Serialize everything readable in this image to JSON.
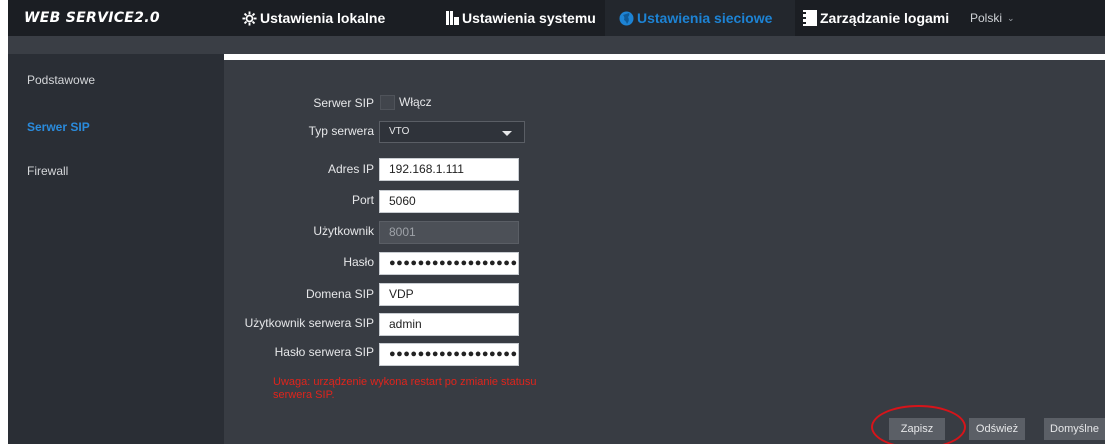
{
  "header": {
    "logo": "WEB SERVICE2.0",
    "nav": [
      {
        "label": "Ustawienia lokalne",
        "icon": "gear-icon"
      },
      {
        "label": "Ustawienia systemu",
        "icon": "system-settings-icon"
      },
      {
        "label": "Ustawienia sieciowe",
        "icon": "globe-icon"
      },
      {
        "label": "Zarządzanie logami",
        "icon": "log-management-icon"
      }
    ],
    "language": "Polski",
    "active_nav": "Ustawienia sieciowe"
  },
  "sidebar": {
    "items": [
      {
        "label": "Podstawowe"
      },
      {
        "label": "Serwer SIP"
      },
      {
        "label": "Firewall"
      }
    ],
    "active_item": "Serwer SIP"
  },
  "form": {
    "sip_server_label": "Serwer SIP",
    "enable_label": "Włącz",
    "enable_checked": false,
    "server_type_label": "Typ serwera",
    "server_type_value": "VTO",
    "ip_label": "Adres IP",
    "ip_value": "192.168.1.111",
    "port_label": "Port",
    "port_value": "5060",
    "user_label": "Użytkownik",
    "user_value": "8001",
    "password_label": "Hasło",
    "password_value": "●●●●●●●●●●●●●●●●●●●",
    "domain_label": "Domena SIP",
    "domain_value": "VDP",
    "server_user_label": "Użytkownik serwera SIP",
    "server_user_value": "admin",
    "server_password_label": "Hasło serwera SIP",
    "server_password_value": "●●●●●●●●●●●●●●●●●●●",
    "warning_line1": "Uwaga: urządzenie wykona restart po zmianie statusu",
    "warning_line2": "serwera SIP."
  },
  "buttons": {
    "save": "Zapisz",
    "refresh": "Odśwież",
    "defaults": "Domyślne"
  },
  "colors": {
    "accent": "#1d83d4",
    "warning": "#e0241c",
    "highlight": "#d7141a"
  }
}
